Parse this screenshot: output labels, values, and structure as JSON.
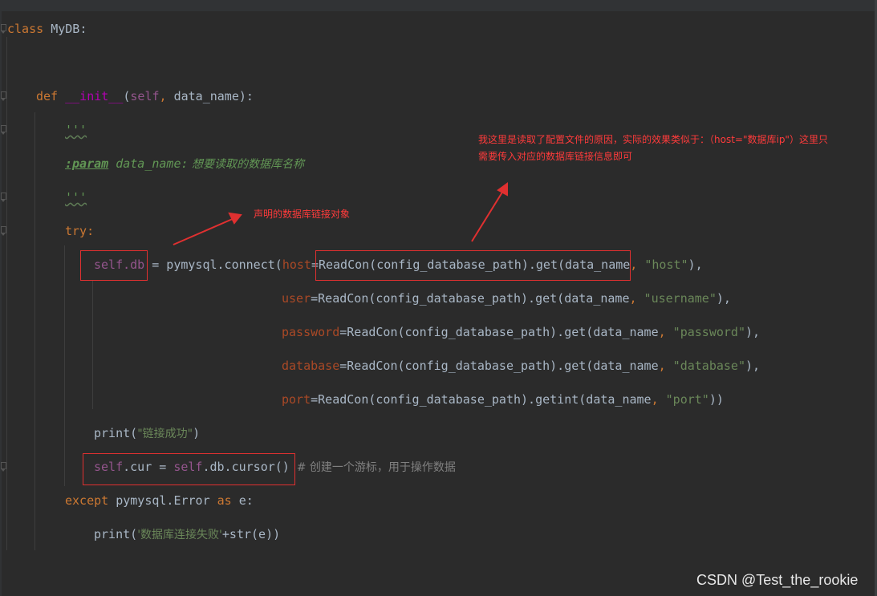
{
  "code": {
    "class_kw": "class",
    "class_name": "MyDB",
    "colon": ":",
    "def_kw": "def",
    "init_name": "__init__",
    "init_params_open": "(",
    "self_kw": "self",
    "comma_space": ", ",
    "data_name_param": "data_name",
    "init_params_close": "):",
    "docstring_quotes": "'''",
    "doc_param_tag": ":param",
    "doc_param_name": " data_name:",
    "doc_param_desc": " 想要读取的数据库名称",
    "try_kw": "try:",
    "self_db": "self.db",
    "assign_connect": " = pymysql.connect(",
    "kw_host": "host",
    "kw_user": "user",
    "kw_password": "password",
    "kw_database": "database",
    "kw_port": "port",
    "eq_readcon_get": "=ReadCon(config_database_path).get(data_name",
    "eq_readcon_getint": "=ReadCon(config_database_path).getint(data_name",
    "str_host": "\"host\"",
    "str_username": "\"username\"",
    "str_password": "\"password\"",
    "str_database": "\"database\"",
    "str_port": "\"port\"",
    "close_comma": "),",
    "close_double": "))",
    "print_open": "print(",
    "print_success_str": "\"链接成功\"",
    "print_close": ")",
    "self_cur_a": "self",
    "self_cur_b": ".cur = ",
    "self_cur_c": "self",
    "self_cur_d": ".db.cursor()",
    "cursor_comment": "  # 创建一个游标，用于操作数据",
    "except_kw": "except",
    "except_mid": " pymysql.Error ",
    "as_kw": "as",
    "except_end": " e:",
    "print_fail_str": "'数据库连接失败'",
    "print_fail_rest": "+str(e))"
  },
  "annotations": {
    "note_self_db": "声明的数据库链接对象",
    "note_config_line1": "我这里是读取了配置文件的原因，实际的效果类似于：（host=\"数据库ip\"）这里只",
    "note_config_line2": "需要传入对应的数据库链接信息即可"
  },
  "watermark": "CSDN @Test_the_rookie",
  "colors": {
    "background": "#2b2b2b",
    "keyword": "#cc7832",
    "string": "#6a8759",
    "self": "#94558d",
    "param_kw": "#aa4926",
    "annotation": "#ff3b3b"
  }
}
